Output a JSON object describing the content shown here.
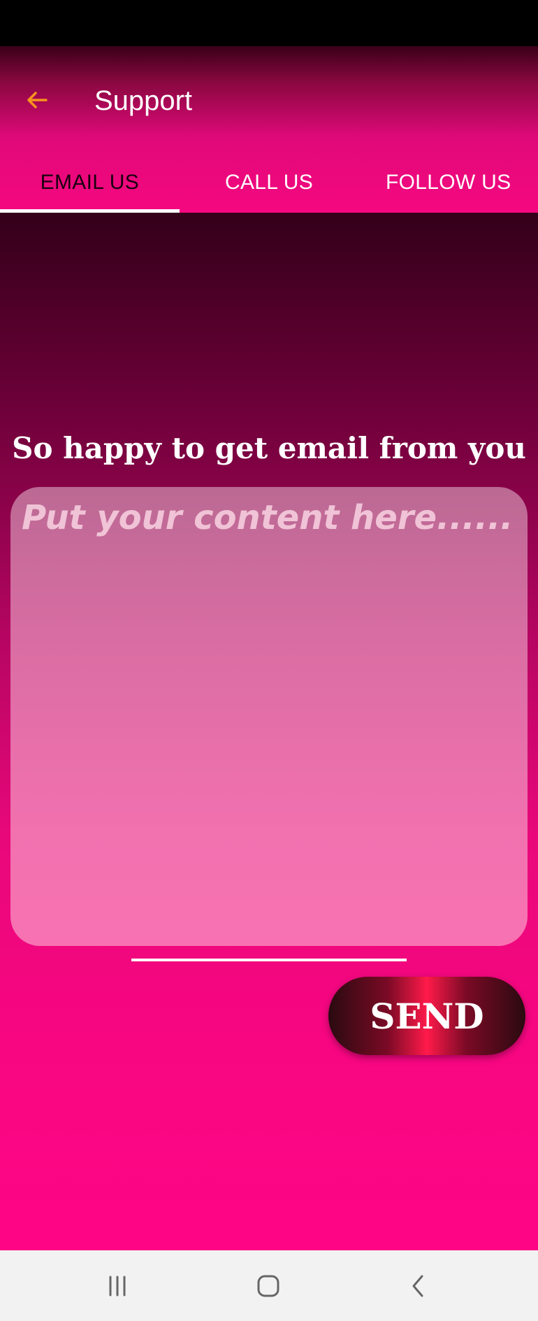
{
  "app": {
    "title": "Support"
  },
  "icons": {
    "back": "arrow-left-icon",
    "recents": "recents-icon",
    "home": "home-icon",
    "nav_back": "chevron-left-icon"
  },
  "colors": {
    "accent": "#f6087f",
    "back_arrow": "#f7941d",
    "active_tab_text": "#1a0010"
  },
  "tabs": [
    {
      "label": "EMAIL US",
      "active": true
    },
    {
      "label": "CALL US",
      "active": false
    },
    {
      "label": "FOLLOW US",
      "active": false
    }
  ],
  "email": {
    "headline": "So happy to get email from you",
    "placeholder": "Put your content here......",
    "value": "",
    "send_label": "SEND"
  }
}
